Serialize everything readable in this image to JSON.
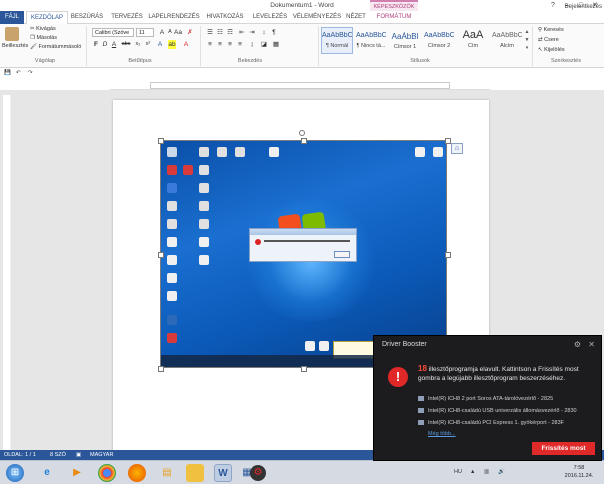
{
  "window": {
    "title": "Dokumentum1 - Word",
    "controls": [
      "?",
      "–",
      "□",
      "✕"
    ],
    "user": "Bejelentkezés"
  },
  "ribbon_tabs": {
    "file": "FÁJL",
    "items": [
      "KEZDŐLAP",
      "BESZÚRÁS",
      "TERVEZÉS",
      "LAPELRENDEZÉS",
      "HIVATKOZÁS",
      "LEVELEZÉS",
      "VÉLEMÉNYEZÉS",
      "NÉZET"
    ],
    "context_group": "KÉPESZKÖZÖK",
    "context_tab": "FORMÁTUM"
  },
  "clipboard": {
    "paste": "Beillesztés",
    "cut": "Kivágás",
    "copy": "Másolás",
    "painter": "Formátummásoló",
    "label": "Vágólap"
  },
  "font": {
    "name": "Calibri (Szöve",
    "size": "11",
    "label": "Betűtípus",
    "format_buttons": [
      "F",
      "D",
      "A",
      "abc",
      "x₂",
      "x²"
    ]
  },
  "paragraph": {
    "label": "Bekezdés"
  },
  "styles": {
    "label": "Stílusok",
    "items": [
      {
        "sample": "AaÁbBbCc",
        "name": "¶ Normál"
      },
      {
        "sample": "AaÁbBbCc",
        "name": "¶ Nincs tá..."
      },
      {
        "sample": "AaÁbBl",
        "name": "Címsor 1"
      },
      {
        "sample": "AaÁbBbC",
        "name": "Címsor 2"
      },
      {
        "sample": "AaA",
        "name": "Cím"
      },
      {
        "sample": "AaÁbBbC",
        "name": "Alcím"
      }
    ]
  },
  "editing": {
    "find": "Keresés",
    "replace": "Csere",
    "select": "Kijelölés",
    "label": "Szerkesztés"
  },
  "statusbar": {
    "page": "OLDAL: 1 / 1",
    "words": "8 SZÓ",
    "language": "MAGYAR"
  },
  "taskbar": {
    "icons": [
      "windows-start",
      "internet-explorer",
      "media-player",
      "chrome",
      "firefox",
      "explorer",
      "folder",
      "word",
      "spreadsheet",
      "driver-booster"
    ],
    "lang": "HU",
    "time": "7:58",
    "date": "2016.11.24."
  },
  "driver_booster": {
    "title": "Driver Booster",
    "count": "18",
    "message_part1": " illesztőprogramja elavult. Kattintson a Frissítés most gombra a legújabb illesztőprogram beszerzéséhez.",
    "items": [
      "Intel(R) ICH8 2 port Soros ATA-tárolóvezérlő - 2825",
      "Intel(R) ICH8-családú USB univerzális állomásvezérlő - 2830",
      "Intel(R) ICH8-családú PCI Express 1. gyökérport - 283F"
    ],
    "more": "Még több...",
    "button": "Frissítés most"
  },
  "colors": {
    "word_blue": "#2b579a",
    "booster_bg": "#1c1c1e",
    "booster_red": "#e02a2a"
  }
}
